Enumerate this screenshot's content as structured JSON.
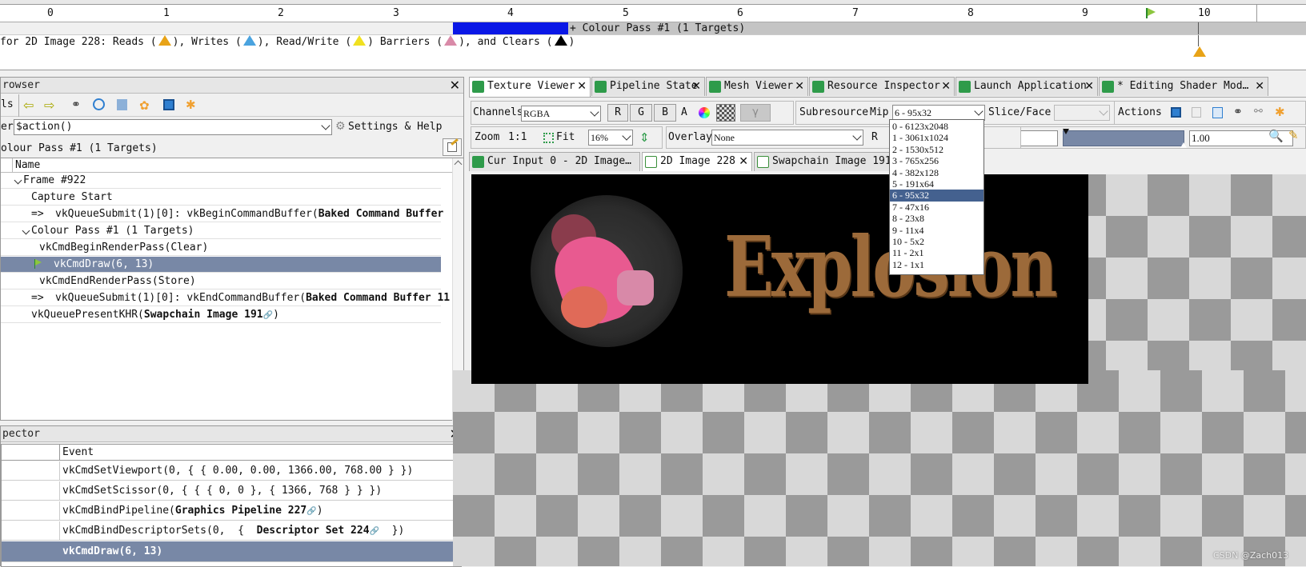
{
  "timeline": {
    "ticks": [
      "0",
      "1",
      "2",
      "3",
      "4",
      "5",
      "6",
      "7",
      "8",
      "9",
      "10"
    ],
    "pass_label": "+ Colour Pass #1 (1 Targets)",
    "legend_prefix": "for 2D Image 228: Reads (",
    "legend_reads_end": "), Writes (",
    "legend_writes_end": "), Read/Write (",
    "legend_rw_end": ") Barriers (",
    "legend_barriers_end": "), and Clears (",
    "legend_end": ")"
  },
  "event_browser": {
    "title": "rowser",
    "toolbar_label": "ls",
    "filter_label": "er",
    "filter_value": "$action()",
    "settings_label": "Settings & Help",
    "breadcrumb": "olour Pass #1 (1 Targets)",
    "column_name": "Name",
    "rows": [
      {
        "prefix": "",
        "text": "Frame #922",
        "bold": ""
      },
      {
        "prefix": "",
        "text": "Capture Start",
        "bold": ""
      },
      {
        "prefix": "=>",
        "text": "vkQueueSubmit(1)[0]:  vkBeginCommandBuffer(",
        "bold": "Baked Command Buffer"
      },
      {
        "prefix": "",
        "text": "Colour Pass #1 (1 Targets)",
        "bold": ""
      },
      {
        "prefix": "",
        "text": "vkCmdBeginRenderPass(Clear)",
        "bold": ""
      },
      {
        "prefix": "",
        "text": "vkCmdDraw(6, 13)",
        "bold": ""
      },
      {
        "prefix": "",
        "text": "vkCmdEndRenderPass(Store)",
        "bold": ""
      },
      {
        "prefix": "=>",
        "text": "vkQueueSubmit(1)[0]:  vkEndCommandBuffer(",
        "bold": "Baked Command Buffer 11"
      },
      {
        "prefix": "",
        "text": "vkQueuePresentKHR(",
        "bold": "Swapchain Image 191"
      }
    ]
  },
  "api_inspector": {
    "title": "pector",
    "column_event": "Event",
    "rows": [
      {
        "text": "vkCmdSetViewport(0, { { 0.00, 0.00, 1366.00, 768.00 } })",
        "bold": "",
        "tail": ""
      },
      {
        "text": "vkCmdSetScissor(0, { { { 0, 0 }, { 1366, 768 } } })",
        "bold": "",
        "tail": ""
      },
      {
        "text": "vkCmdBindPipeline(",
        "bold": "Graphics Pipeline 227",
        "tail": ")"
      },
      {
        "text": "vkCmdBindDescriptorSets(0,  {  ",
        "bold": "Descriptor Set 224",
        "tail": "  })"
      },
      {
        "text": "vkCmdDraw(6, 13)",
        "bold": "",
        "tail": ""
      }
    ]
  },
  "tabs": [
    "Texture Viewer",
    "Pipeline State",
    "Mesh Viewer",
    "Resource Inspector",
    "Launch Application",
    "* Editing Shader Mod…"
  ],
  "texture_toolbar": {
    "channels_label": "Channels",
    "channels_value": "RGBA",
    "btn_r": "R",
    "btn_g": "G",
    "btn_b": "B",
    "btn_a": "A",
    "subresource_label": "Subresource",
    "mip_label": "Mip",
    "mip_value": "6 - 95x32",
    "slice_label": "Slice/Face",
    "actions_label": "Actions",
    "zoom_label": "Zoom",
    "zoom_1to1": "1:1",
    "fit_label": "Fit",
    "zoom_value": "16%",
    "overlay_label": "Overlay",
    "overlay_value": "None",
    "range_label": "R",
    "range_max": "1.00"
  },
  "subtabs": [
    "Cur Input 0 - 2D Image…",
    "2D Image 228",
    "Swapchain Image 191"
  ],
  "mip_options": [
    "0 - 6123x2048",
    "1 - 3061x1024",
    "2 - 1530x512",
    "3 - 765x256",
    "4 - 382x128",
    "5 - 191x64",
    "6 - 95x32",
    "7 - 47x16",
    "8 - 23x8",
    "9 - 11x4",
    "10 - 5x2",
    "11 - 2x1",
    "12 - 1x1"
  ],
  "mip_selected_index": 6,
  "texture_text": "Explosion",
  "watermark": "CSDN @Zach013",
  "colors": {
    "selection": "#7888a6",
    "pass_bar": "#0a17e6",
    "read_marker": "#e8a317",
    "write_marker": "#4aa3df",
    "rw_marker": "#f0e020",
    "barrier_marker": "#d98aa8",
    "clear_marker": "#000000"
  }
}
